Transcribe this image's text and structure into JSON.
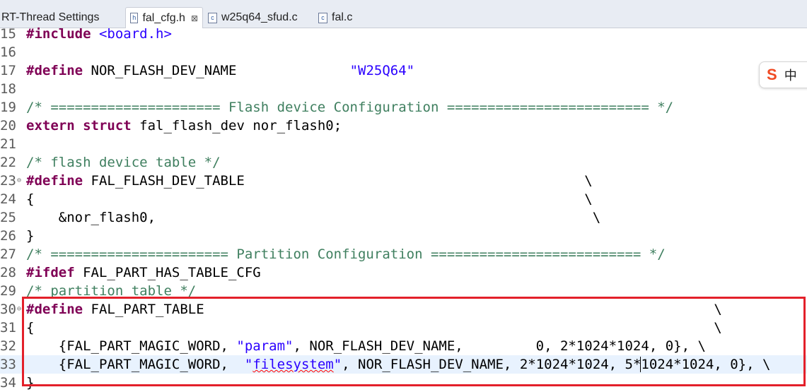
{
  "tabs": [
    {
      "label": "RT-Thread Settings",
      "icon": "none"
    },
    {
      "label": "fal_cfg.h",
      "icon": "h",
      "active": true,
      "close": "⊠"
    },
    {
      "label": "w25q64_sfud.c",
      "icon": "c"
    },
    {
      "label": "fal.c",
      "icon": "c"
    }
  ],
  "ime": {
    "logo": "S",
    "mode": "中"
  },
  "lines": [
    {
      "n": "15",
      "html": "<span class='kw'>#include</span> <span class='str'>&lt;board.h&gt;</span>"
    },
    {
      "n": "16",
      "html": ""
    },
    {
      "n": "17",
      "html": "<span class='kw'>#define</span> NOR_FLASH_DEV_NAME              <span class='str'>\"W25Q64\"</span>"
    },
    {
      "n": "18",
      "html": ""
    },
    {
      "n": "19",
      "html": "<span class='cm'>/* ===================== Flash device Configuration ========================= */</span>"
    },
    {
      "n": "20",
      "html": "<span class='kw'>extern</span> <span class='kw'>struct</span> fal_flash_dev nor_flash0;"
    },
    {
      "n": "21",
      "html": ""
    },
    {
      "n": "22",
      "html": "<span class='cm'>/* flash device table */</span>"
    },
    {
      "n": "23",
      "fold": true,
      "html": "<span class='kw'>#define</span> FAL_FLASH_DEV_TABLE                                          \\"
    },
    {
      "n": "24",
      "html": "{                                                                    \\"
    },
    {
      "n": "25",
      "html": "    &amp;nor_flash0,                                                      \\"
    },
    {
      "n": "26",
      "html": "}"
    },
    {
      "n": "27",
      "html": "<span class='cm'>/* ====================== Partition Configuration ========================== */</span>"
    },
    {
      "n": "28",
      "html": "<span class='kw'>#ifdef</span> FAL_PART_HAS_TABLE_CFG"
    },
    {
      "n": "29",
      "html": "<span class='cm'>/* partition table */</span>"
    },
    {
      "n": "30",
      "fold": true,
      "html": "<span class='kw'>#define</span> FAL_PART_TABLE                                                               \\"
    },
    {
      "n": "31",
      "html": "{                                                                                    \\"
    },
    {
      "n": "32",
      "html": "    {FAL_PART_MAGIC_WORD, <span class='str'>\"param\"</span>, NOR_FLASH_DEV_NAME,         0, 2*1024*1024, 0}, \\"
    },
    {
      "n": "33",
      "cur": true,
      "html": "    {FAL_PART_MAGIC_WORD,  <span class='str'>\"<span class='sq'>filesystem</span>\"</span>, NOR_FLASH_DEV_NAME, 2*1024*1024, 5*<span class='caret'></span>1024*1024, 0}, \\"
    },
    {
      "n": "34",
      "html": "}"
    }
  ]
}
